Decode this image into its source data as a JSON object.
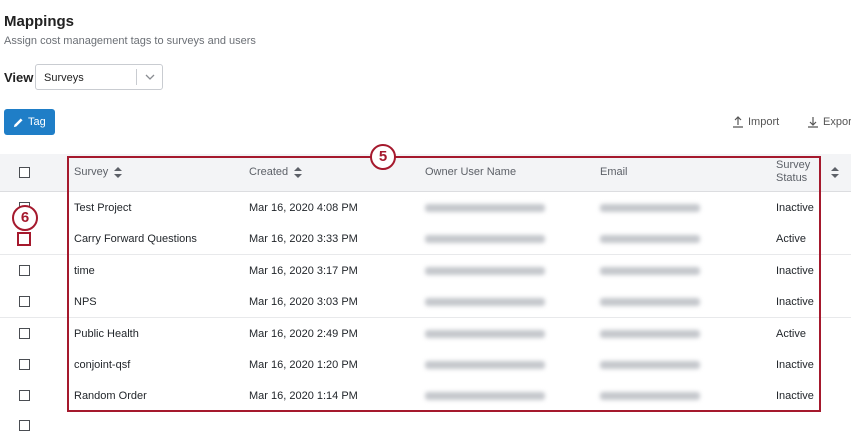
{
  "page": {
    "title": "Mappings",
    "subtitle": "Assign cost management tags to surveys and users"
  },
  "view": {
    "label": "View",
    "selected": "Surveys"
  },
  "toolbar": {
    "tag_label": "Tag",
    "import_label": "Import",
    "export_label": "Export"
  },
  "table": {
    "columns": {
      "survey": "Survey",
      "created": "Created",
      "owner": "Owner User Name",
      "email": "Email",
      "status_line1": "Survey",
      "status_line2": "Status"
    },
    "rows": [
      {
        "survey": "Test Project",
        "created": "Mar 16, 2020 4:08 PM",
        "owner": "",
        "email": "",
        "status": "Inactive"
      },
      {
        "survey": "Carry Forward Questions",
        "created": "Mar 16, 2020 3:33 PM",
        "owner": "",
        "email": "",
        "status": "Active"
      },
      {
        "survey": "time",
        "created": "Mar 16, 2020 3:17 PM",
        "owner": "",
        "email": "",
        "status": "Inactive"
      },
      {
        "survey": "NPS",
        "created": "Mar 16, 2020 3:03 PM",
        "owner": "",
        "email": "",
        "status": "Inactive"
      },
      {
        "survey": "Public Health",
        "created": "Mar 16, 2020 2:49 PM",
        "owner": "",
        "email": "",
        "status": "Active"
      },
      {
        "survey": "conjoint-qsf",
        "created": "Mar 16, 2020 1:20 PM",
        "owner": "",
        "email": "",
        "status": "Inactive"
      },
      {
        "survey": "Random Order",
        "created": "Mar 16, 2020 1:14 PM",
        "owner": "",
        "email": "",
        "status": "Inactive"
      }
    ]
  },
  "callouts": {
    "badge_5": "5",
    "badge_6": "6"
  },
  "colors": {
    "accent": "#1f7ec7",
    "callout": "#a5192d"
  }
}
